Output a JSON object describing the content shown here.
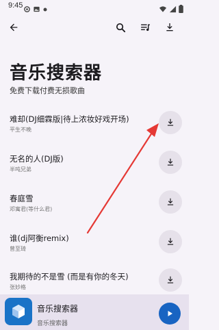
{
  "status": {
    "time": "9:45"
  },
  "app_bar": {
    "icons": [
      "back-arrow-icon",
      "search-icon",
      "queue-music-icon",
      "download-icon"
    ]
  },
  "header": {
    "title": "音乐搜索器",
    "subtitle": "免费下载付费无损歌曲"
  },
  "songs": [
    {
      "title": "难却(DJ细霖版|待上浓妆好戏开场)",
      "artist": "平生不晚"
    },
    {
      "title": "无名的人(DJ版)",
      "artist": "半吨兄弟"
    },
    {
      "title": "春庭雪",
      "artist": "邓寓君(等什么君)"
    },
    {
      "title": "谁(dj阿衡remix)",
      "artist": "曾至琦"
    },
    {
      "title": "我期待的不是雪 (而是有你的冬天)",
      "artist": "张妙格"
    }
  ],
  "player": {
    "title": "音乐搜索器",
    "subtitle": "音乐搜索器"
  },
  "colors": {
    "background": "#f6f3f9",
    "accent": "#1864c2",
    "arrow": "#e53935"
  }
}
